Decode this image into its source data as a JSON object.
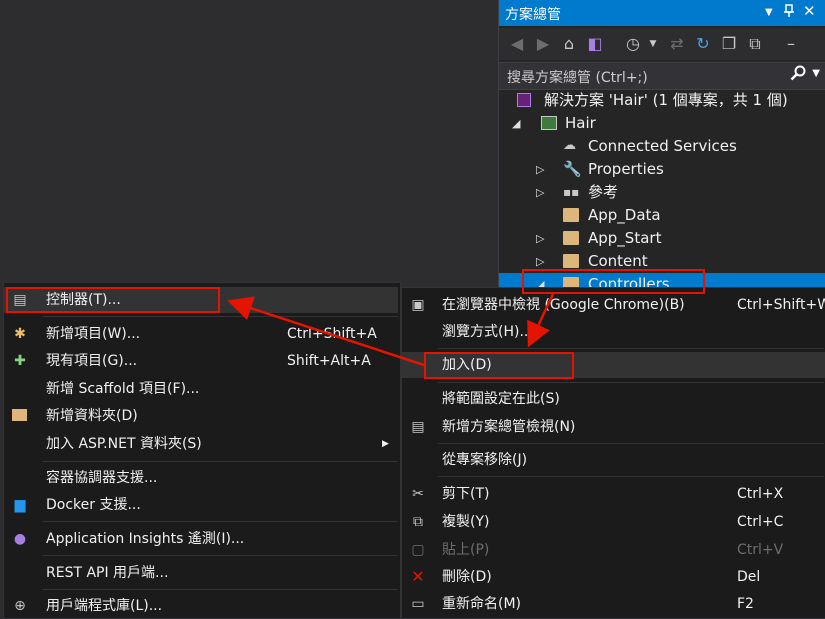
{
  "solution_explorer": {
    "title": "方案總管",
    "search_placeholder": "搜尋方案總管 (Ctrl+;)",
    "tree": [
      {
        "label": "解決方案 'Hair' (1 個專案，共 1 個)",
        "icon": "solution-icon"
      },
      {
        "label": "Hair",
        "icon": "web-project-icon"
      },
      {
        "label": "Connected Services",
        "icon": "connected-services-icon"
      },
      {
        "label": "Properties",
        "icon": "wrench-icon"
      },
      {
        "label": "參考",
        "icon": "references-icon"
      },
      {
        "label": "App_Data",
        "icon": "folder-icon"
      },
      {
        "label": "App_Start",
        "icon": "folder-icon"
      },
      {
        "label": "Content",
        "icon": "folder-icon"
      },
      {
        "label": "Controllers",
        "icon": "folder-icon"
      }
    ]
  },
  "context_menu": {
    "items": [
      {
        "label": "在瀏覽器中檢視 (Google Chrome)(B)",
        "shortcut": "Ctrl+Shift+W",
        "icon": "browser-view-icon"
      },
      {
        "label": "瀏覽方式(H)...",
        "shortcut": "",
        "icon": ""
      },
      {
        "label": "加入(D)",
        "shortcut": "",
        "icon": ""
      },
      {
        "label": "將範圍設定在此(S)",
        "shortcut": "",
        "icon": ""
      },
      {
        "label": "新增方案總管檢視(N)",
        "shortcut": "",
        "icon": "new-view-icon"
      },
      {
        "label": "從專案移除(J)",
        "shortcut": "",
        "icon": ""
      },
      {
        "label": "剪下(T)",
        "shortcut": "Ctrl+X",
        "icon": "scissors-icon"
      },
      {
        "label": "複製(Y)",
        "shortcut": "Ctrl+C",
        "icon": "copy-icon"
      },
      {
        "label": "貼上(P)",
        "shortcut": "Ctrl+V",
        "icon": "paste-icon",
        "disabled": true
      },
      {
        "label": "刪除(D)",
        "shortcut": "Del",
        "icon": "delete-icon"
      },
      {
        "label": "重新命名(M)",
        "shortcut": "F2",
        "icon": "rename-icon"
      }
    ]
  },
  "add_submenu": {
    "items": [
      {
        "label": "控制器(T)...",
        "shortcut": "",
        "icon": "controller-icon"
      },
      {
        "label": "新增項目(W)...",
        "shortcut": "Ctrl+Shift+A",
        "icon": "new-item-icon"
      },
      {
        "label": "現有項目(G)...",
        "shortcut": "Shift+Alt+A",
        "icon": "existing-item-icon"
      },
      {
        "label": "新增 Scaffold 項目(F)...",
        "shortcut": "",
        "icon": ""
      },
      {
        "label": "新增資料夾(D)",
        "shortcut": "",
        "icon": "new-folder-icon"
      },
      {
        "label": "加入 ASP.NET 資料夾(S)",
        "shortcut": "",
        "icon": ""
      },
      {
        "label": "容器協調器支援...",
        "shortcut": "",
        "icon": ""
      },
      {
        "label": "Docker 支援...",
        "shortcut": "",
        "icon": "docker-icon"
      },
      {
        "label": "Application Insights 遙測(I)...",
        "shortcut": "",
        "icon": "insights-icon"
      },
      {
        "label": "REST API 用戶端...",
        "shortcut": "",
        "icon": ""
      },
      {
        "label": "用戶端程式庫(L)...",
        "shortcut": "",
        "icon": "client-library-icon"
      }
    ]
  }
}
